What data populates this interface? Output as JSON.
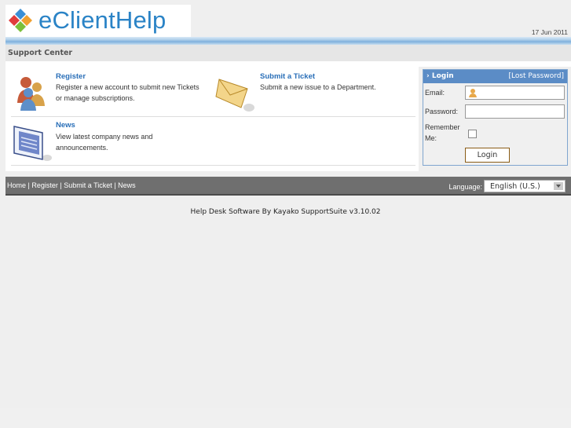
{
  "header": {
    "logo_text": "eClientHelp",
    "date": "17 Jun 2011"
  },
  "support_center": {
    "title": "Support Center"
  },
  "items": [
    {
      "title": "Register",
      "desc1": "Register a new account to submit new Tickets",
      "desc2": "or manage subscriptions."
    },
    {
      "title": "Submit a Ticket",
      "desc1": "Submit a new issue to a Department.",
      "desc2": ""
    },
    {
      "title": "News",
      "desc1": "View latest company news and",
      "desc2": "announcements."
    }
  ],
  "login": {
    "title": "Login",
    "lost_password": "[Lost Password]",
    "email_label": "Email:",
    "password_label": "Password:",
    "remember_label1": "Remember",
    "remember_label2": "Me:",
    "button": "Login"
  },
  "footer": {
    "home": "Home",
    "register": "Register",
    "submit": "Submit a Ticket",
    "news": "News",
    "separator": " | ",
    "language_label": "Language:",
    "language_value": "English (U.S.)"
  },
  "powered_by": "Help Desk Software By Kayako SupportSuite v3.10.02",
  "colors": {
    "accent": "#2a6fb8",
    "login_header": "#5b8cc6",
    "footer_bg": "#6f6f6f"
  }
}
